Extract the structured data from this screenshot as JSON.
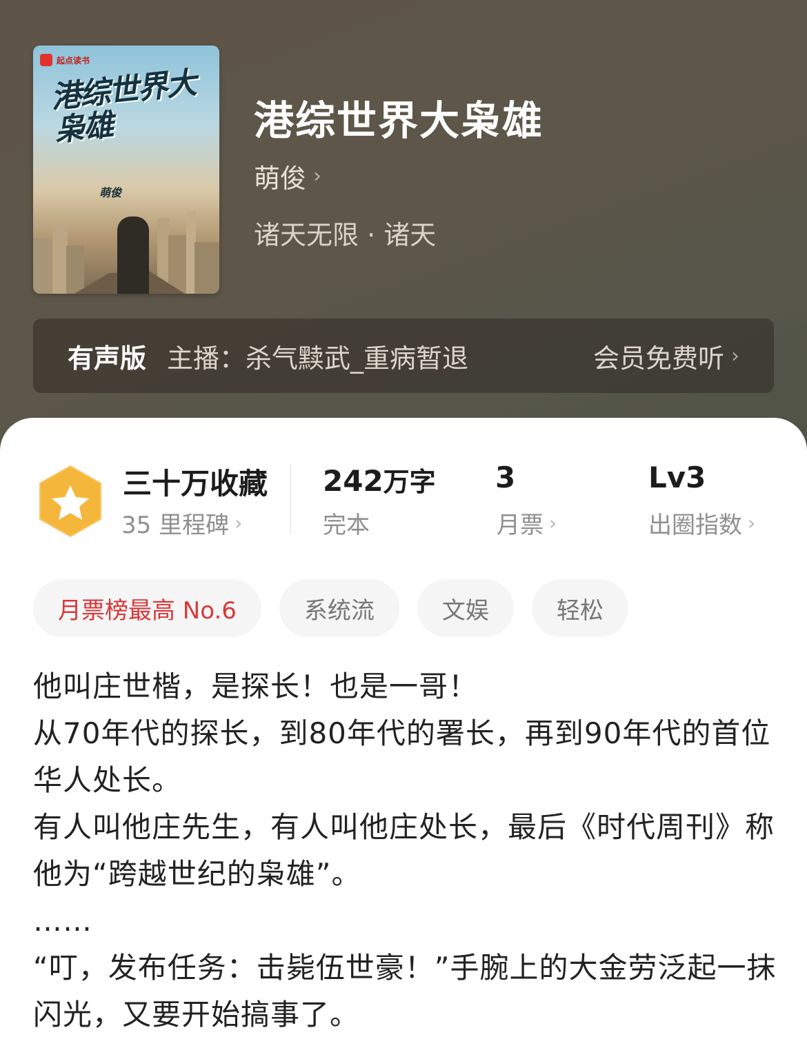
{
  "book": {
    "title": "港综世界大枭雄",
    "author": "萌俊",
    "genre": "诸天无限 · 诸天",
    "cover": {
      "brand": "起点读书",
      "title": "港综世界大枭雄",
      "author": "萌俊"
    }
  },
  "audio": {
    "label": "有声版",
    "host": "主播：杀气黩武_重病暂退",
    "cta": "会员免费听"
  },
  "stats": {
    "collect_main": "三十万收藏",
    "collect_sub": "35 里程碑",
    "words_num": "242",
    "words_unit": "万字",
    "words_sub": "完本",
    "tickets_main": "3",
    "tickets_sub": "月票",
    "level_main": "Lv3",
    "level_sub": "出圈指数"
  },
  "tags": [
    "月票榜最高 No.6",
    "系统流",
    "文娱",
    "轻松"
  ],
  "description": [
    "他叫庄世楷，是探长！也是一哥！",
    "从70年代的探长，到80年代的署长，再到90年代的首位华人处长。",
    "有人叫他庄先生，有人叫他庄处长，最后《时代周刊》称他为“跨越世纪的枭雄”。",
    "……",
    "“叮，发布任务：击毙伍世豪！”手腕上的大金劳泛起一抹闪光，又要开始搞事了。"
  ],
  "colors": {
    "header_bg": "#5d5749",
    "rank_tag": "#d8383a",
    "badge": "#f5b63c"
  }
}
